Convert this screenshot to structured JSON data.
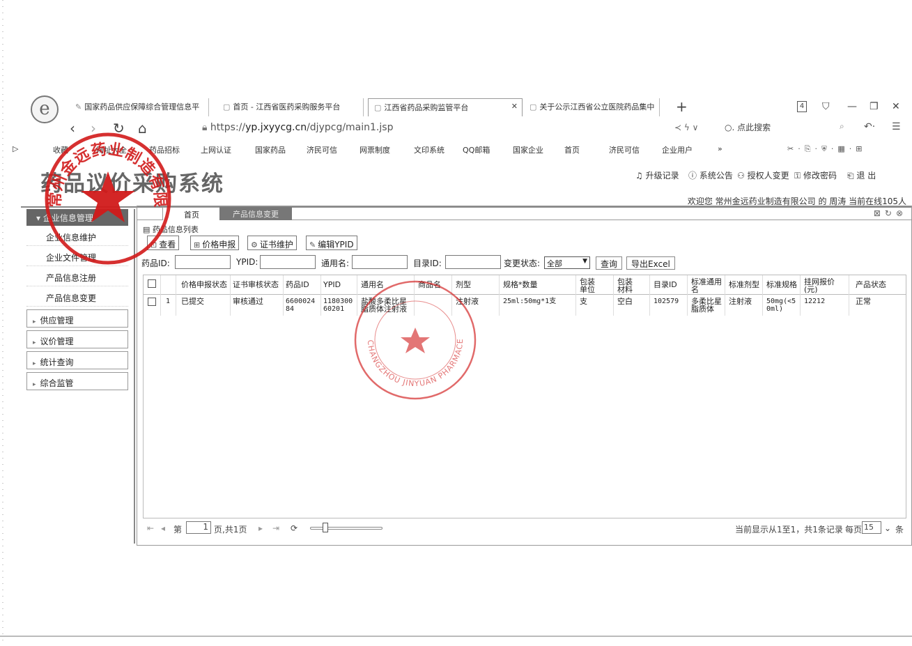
{
  "browser": {
    "tabs": [
      {
        "label": "国家药品供应保障综合管理信息平"
      },
      {
        "label": "首页 - 江西省医药采购服务平台"
      },
      {
        "label": "江西省药品采购监管平台"
      },
      {
        "label": "关于公示江西省公立医院药品集中"
      }
    ],
    "tab_count": "4",
    "url_prefix": "https://",
    "url_domain": "yp.jxyycg.cn",
    "url_path": "/djypcg/main1.jsp",
    "search_placeholder": "点此搜索",
    "bookmarks": [
      "收藏",
      "网址大全",
      "药品招标",
      "上网认证",
      "国家药品",
      "济民可信",
      "网票制度",
      "文印系统",
      "QQ邮箱",
      "国家企业",
      "首页",
      "济民可信",
      "企业用户",
      "»"
    ]
  },
  "app": {
    "title": "药品议价采购系统",
    "links": [
      "升级记录",
      "系统公告",
      "授权人变更",
      "修改密码",
      "退 出"
    ],
    "welcome": "欢迎您 常州金远药业制造有限公司 的 周涛  当前在线105人"
  },
  "sidebar": {
    "section_title": "企业信息管理",
    "sub_items": [
      "企业信息维护",
      "企业文件管理",
      "产品信息注册",
      "产品信息变更"
    ],
    "groups": [
      "供应管理",
      "议价管理",
      "统计查询",
      "综合监管"
    ]
  },
  "content": {
    "tabs": [
      "首页",
      "产品信息变更"
    ],
    "panel_title": "药品信息列表",
    "toolbar": [
      "查看",
      "价格申报",
      "证书维护",
      "编辑YPID"
    ],
    "filters": {
      "drug_id_label": "药品ID:",
      "ypid_label": "YPID:",
      "generic_label": "通用名:",
      "catalog_label": "目录ID:",
      "status_label": "变更状态:",
      "status_value": "全部",
      "query_button": "查询",
      "export_button": "导出Excel"
    },
    "columns": [
      "价格申报状态",
      "证书审核状态",
      "药品ID",
      "YPID",
      "通用名",
      "商品名",
      "剂型",
      "规格*数量",
      "包装单位",
      "包装材料",
      "目录ID",
      "标准通用名",
      "标准剂型",
      "标准规格",
      "挂网报价(元)",
      "产品状态"
    ],
    "rows": [
      {
        "index": "1",
        "price_status": "已提交",
        "cert_status": "审核通过",
        "drug_id": "660002484",
        "ypid": "118030060201",
        "generic_name": "盐酸多柔比星脂质体注射液",
        "trade_name": "",
        "dosage_form": "注射液",
        "spec": "25ml:50mg*1支",
        "pack_unit": "支",
        "pack_material": "空白",
        "catalog_id": "102579",
        "std_generic": "多柔比星脂质体",
        "std_form": "注射液",
        "std_spec": "50mg(<50ml)",
        "price": "12212",
        "product_status": "正常"
      }
    ],
    "pager": {
      "page_prefix": "第",
      "page_value": "1",
      "page_suffix": "页,共1页",
      "summary": "当前显示从1至1，共1条记录",
      "per_page_label": "每页",
      "per_page_value": "15",
      "per_page_suffix": "条"
    }
  },
  "stamps": {
    "company_seal_text": "常州金远药业制造有限公司",
    "round_seal_text": "CHANGZHOU JINYUAN PHARMACEUTICALS CO.,LTD"
  },
  "colors": {
    "seal_red": "#d11a1a",
    "header_gray": "#666666"
  }
}
